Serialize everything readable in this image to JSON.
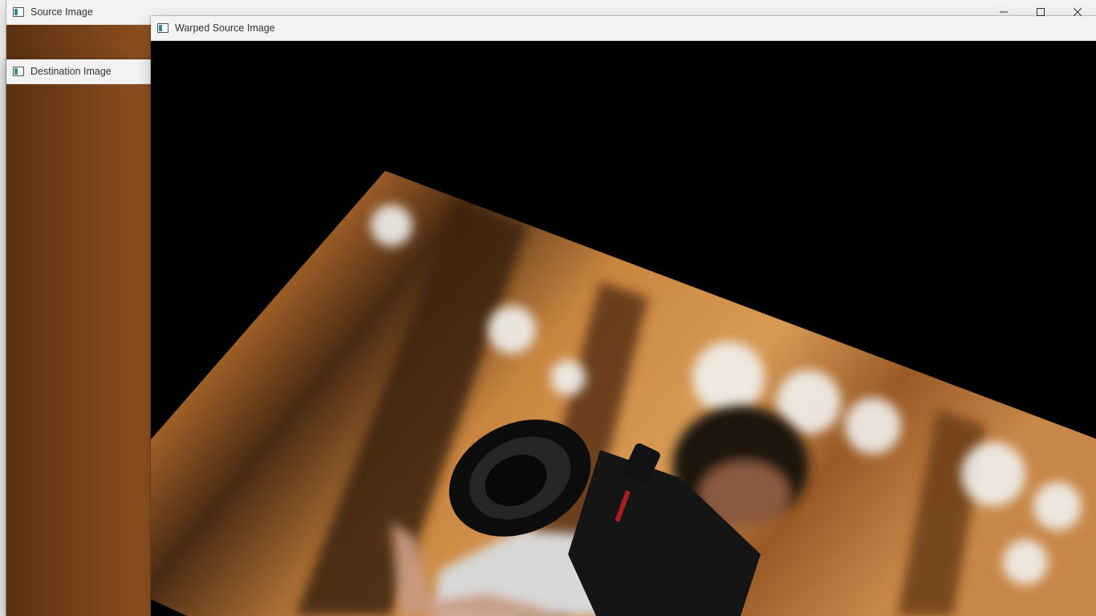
{
  "windows": {
    "source": {
      "title": "Source Image"
    },
    "destination": {
      "title": "Destination Image"
    },
    "warped": {
      "title": "Warped Source Image"
    }
  },
  "icons": {
    "app_icon": "image-window-icon",
    "minimize": "minimize-icon",
    "maximize": "maximize-icon",
    "close": "close-icon"
  },
  "colors": {
    "titlebar": "#f3f3f3",
    "canvas_background": "#000000",
    "accent_teal": "#3a8a8c"
  }
}
